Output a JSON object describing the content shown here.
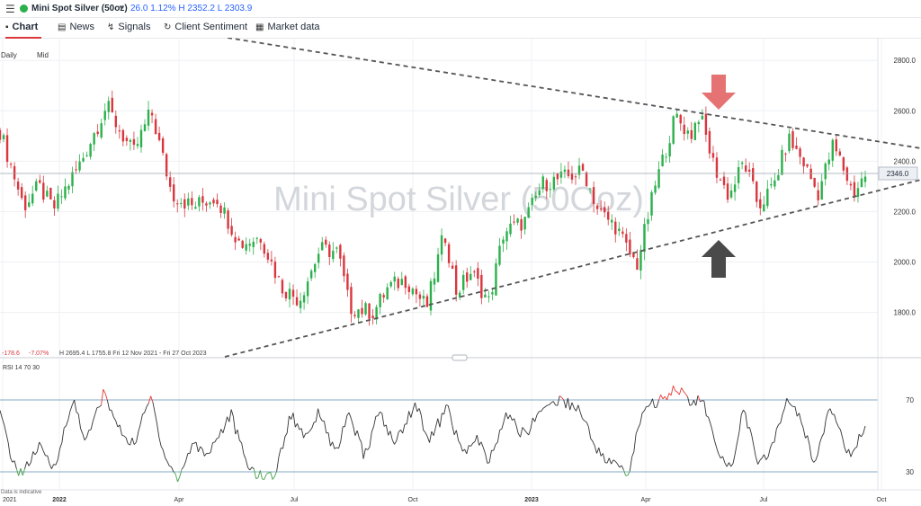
{
  "topbar": {
    "symbol": "Mini Spot Silver (50oz)",
    "quote": "26.0  1.12%  H 2352.2  L 2303.9"
  },
  "tabs": [
    {
      "label": "Chart",
      "icon": "chart-icon"
    },
    {
      "label": "News",
      "icon": "news-icon"
    },
    {
      "label": "Signals",
      "icon": "signals-icon"
    },
    {
      "label": "Client Sentiment",
      "icon": "sentiment-icon"
    },
    {
      "label": "Market data",
      "icon": "market-data-icon"
    }
  ],
  "toolbar": {
    "interval": "Daily",
    "price_type": "Mid"
  },
  "stats": {
    "change": "-178.6",
    "change_pct": "-7.07%",
    "range": "H 2695.4   L 1755.8   Fri 12 Nov 2021 - Fri 27 Oct 2023"
  },
  "rsi_label": "RSI  14  70  30",
  "disclaimer": "Data is indicative",
  "watermark": "Mini Spot Silver (50Ooz)",
  "colors": {
    "up": "#2bb04b",
    "down": "#d9363e",
    "overbought": "#e53935",
    "oversold": "#43a047",
    "rsi_line": "#333333",
    "trendline": "#555555",
    "arrow_down": "#e57373",
    "arrow_up": "#4a4a4a"
  },
  "chart_data": [
    {
      "type": "candlestick",
      "x_labels": [
        "2021",
        "2022",
        "Apr",
        "Jul",
        "Oct",
        "2023",
        "Apr",
        "Jul",
        "Oct"
      ],
      "y_ticks": [
        1800,
        2000,
        2200,
        2400,
        2600,
        2800
      ],
      "ylim": [
        1620,
        2890
      ],
      "current_price": 2346.0,
      "close_path": [
        [
          2021.97,
          2520
        ],
        [
          2022.05,
          2220
        ],
        [
          2022.1,
          2300
        ],
        [
          2022.15,
          2210
        ],
        [
          2022.24,
          2390
        ],
        [
          2022.33,
          2620
        ],
        [
          2022.37,
          2530
        ],
        [
          2022.42,
          2430
        ],
        [
          2022.48,
          2600
        ],
        [
          2022.55,
          2270
        ],
        [
          2022.62,
          2220
        ],
        [
          2022.7,
          2260
        ],
        [
          2022.78,
          2070
        ],
        [
          2022.85,
          2100
        ],
        [
          2022.92,
          1900
        ],
        [
          2022.98,
          1850
        ],
        [
          2023.05,
          2050
        ],
        [
          2023.11,
          2040
        ],
        [
          2023.15,
          1820
        ],
        [
          2023.23,
          1800
        ],
        [
          2023.28,
          1900
        ],
        [
          2023.34,
          1930
        ],
        [
          2023.41,
          1820
        ],
        [
          2023.47,
          2120
        ],
        [
          2023.51,
          1880
        ],
        [
          2023.56,
          1960
        ],
        [
          2023.62,
          1840
        ],
        [
          2023.67,
          2120
        ],
        [
          2023.74,
          2160
        ],
        [
          2023.8,
          2310
        ],
        [
          2023.89,
          2340
        ],
        [
          2023.94,
          2360
        ],
        [
          2023.99,
          2200
        ],
        [
          2024.05,
          2140
        ],
        [
          2024.09,
          2040
        ],
        [
          2024.12,
          1990
        ],
        [
          2024.18,
          2300
        ],
        [
          2024.25,
          2580
        ],
        [
          2024.3,
          2500
        ],
        [
          2024.33,
          2590
        ],
        [
          2024.38,
          2380
        ],
        [
          2024.43,
          2260
        ],
        [
          2024.48,
          2400
        ],
        [
          2024.53,
          2220
        ],
        [
          2024.58,
          2300
        ],
        [
          2024.63,
          2490
        ],
        [
          2024.68,
          2400
        ],
        [
          2024.73,
          2270
        ],
        [
          2024.78,
          2460
        ],
        [
          2024.8,
          2420
        ],
        [
          2024.85,
          2270
        ],
        [
          2024.89,
          2346
        ]
      ]
    },
    {
      "type": "line",
      "label": "RSI",
      "levels": [
        30,
        70
      ],
      "ylim": [
        20,
        90
      ],
      "y_ticks": [
        30,
        70
      ],
      "values": [
        [
          2021.97,
          62
        ],
        [
          2022.02,
          32
        ],
        [
          2022.05,
          30
        ],
        [
          2022.1,
          44
        ],
        [
          2022.15,
          32
        ],
        [
          2022.22,
          70
        ],
        [
          2022.26,
          46
        ],
        [
          2022.32,
          74
        ],
        [
          2022.37,
          54
        ],
        [
          2022.42,
          45
        ],
        [
          2022.48,
          72
        ],
        [
          2022.52,
          42
        ],
        [
          2022.57,
          25
        ],
        [
          2022.62,
          46
        ],
        [
          2022.67,
          40
        ],
        [
          2022.75,
          62
        ],
        [
          2022.8,
          35
        ],
        [
          2022.85,
          27
        ],
        [
          2022.9,
          29
        ],
        [
          2022.95,
          62
        ],
        [
          2023.0,
          50
        ],
        [
          2023.05,
          64
        ],
        [
          2023.1,
          40
        ],
        [
          2023.15,
          62
        ],
        [
          2023.2,
          38
        ],
        [
          2023.25,
          64
        ],
        [
          2023.3,
          45
        ],
        [
          2023.37,
          68
        ],
        [
          2023.42,
          48
        ],
        [
          2023.48,
          66
        ],
        [
          2023.53,
          40
        ],
        [
          2023.58,
          48
        ],
        [
          2023.62,
          35
        ],
        [
          2023.68,
          62
        ],
        [
          2023.74,
          50
        ],
        [
          2023.8,
          66
        ],
        [
          2023.86,
          70
        ],
        [
          2023.92,
          66
        ],
        [
          2024.0,
          38
        ],
        [
          2024.05,
          34
        ],
        [
          2024.09,
          28
        ],
        [
          2024.14,
          66
        ],
        [
          2024.2,
          70
        ],
        [
          2024.25,
          78
        ],
        [
          2024.3,
          68
        ],
        [
          2024.34,
          71
        ],
        [
          2024.4,
          36
        ],
        [
          2024.44,
          34
        ],
        [
          2024.48,
          66
        ],
        [
          2024.53,
          32
        ],
        [
          2024.58,
          46
        ],
        [
          2024.63,
          72
        ],
        [
          2024.68,
          55
        ],
        [
          2024.72,
          34
        ],
        [
          2024.77,
          68
        ],
        [
          2024.8,
          58
        ],
        [
          2024.84,
          36
        ],
        [
          2024.89,
          56
        ]
      ]
    }
  ]
}
